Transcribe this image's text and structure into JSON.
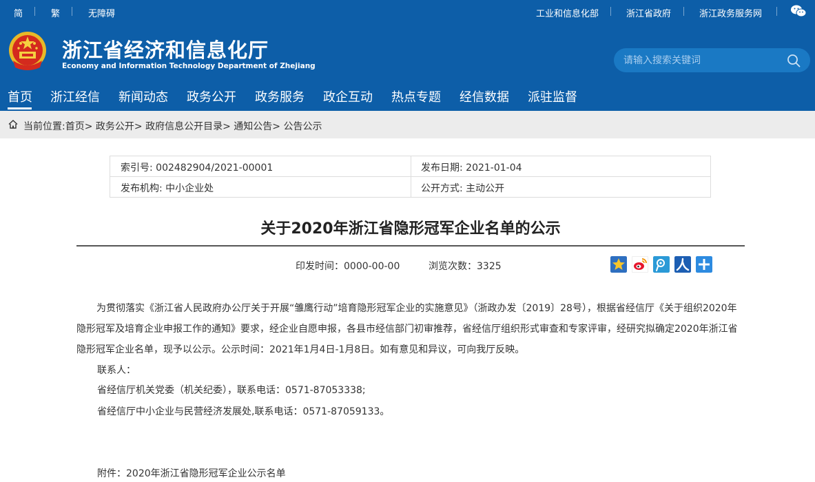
{
  "topbar": {
    "left_links": [
      "简",
      "繁",
      "无障碍"
    ],
    "right_links": [
      "工业和信息化部",
      "浙江省政府",
      "浙江政务服务网"
    ]
  },
  "site": {
    "title": "浙江省经济和信息化厅",
    "subtitle": "Economy and Information Technology Department of Zhejiang"
  },
  "search": {
    "placeholder": "请输入搜索关键词"
  },
  "nav": {
    "items": [
      "首页",
      "浙江经信",
      "新闻动态",
      "政务公开",
      "政务服务",
      "政企互动",
      "热点专题",
      "经信数据",
      "派驻监督"
    ],
    "active": "首页"
  },
  "breadcrumb": {
    "prefix": "当前位置:",
    "items": [
      "首页",
      "政务公开",
      "政府信息公开目录",
      "通知公告",
      "公告公示"
    ]
  },
  "meta": {
    "index_label": "索引号:",
    "index_value": "002482904/2021-00001",
    "date_label": "发布日期:",
    "date_value": "2021-01-04",
    "org_label": "发布机构:",
    "org_value": "中小企业处",
    "mode_label": "公开方式:",
    "mode_value": "主动公开"
  },
  "article": {
    "title": "关于2020年浙江省隐形冠军企业名单的公示",
    "print_time": "印发时间：0000-00-00",
    "views": "浏览次数：3325",
    "paragraph1": "为贯彻落实《浙江省人民政府办公厅关于开展“雏鹰行动”培育隐形冠军企业的实施意见》（浙政办发〔2019〕28号），根据省经信厅《关于组织2020年隐形冠军及培育企业申报工作的通知》要求，经企业自愿申报，各县市经信部门初审推荐，省经信厅组织形式审查和专家评审，经研究拟确定2020年浙江省隐形冠军企业名单，现予以公示。公示时间：2021年1月4日-1月8日。如有意见和异议，可向我厅反映。",
    "contact_label": "联系人：",
    "contact1": "省经信厅机关党委（机关纪委），联系电话：0571-87053338;",
    "contact2": "省经信厅中小企业与民营经济发展处,联系电话：0571-87059133。",
    "attachment": "附件：2020年浙江省隐形冠军企业公示名单"
  },
  "colors": {
    "header_bg": "#0d5ea8",
    "search_bg": "#1a79c4",
    "crumb_bg": "#ececec"
  },
  "share_icons": [
    "favorite-icon",
    "weibo-icon",
    "tencent-weibo-icon",
    "renren-icon",
    "more-share-icon"
  ]
}
